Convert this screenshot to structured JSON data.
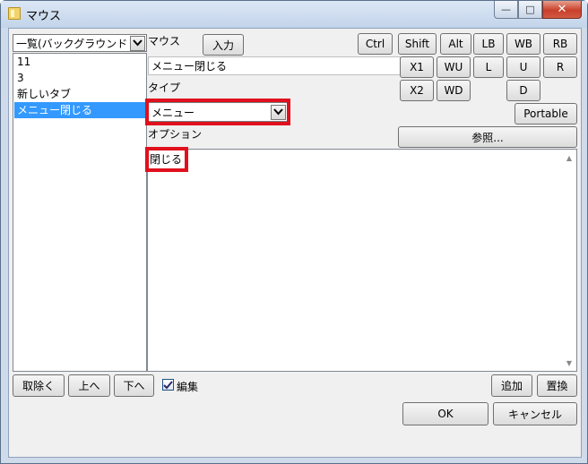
{
  "window": {
    "title": "マウス",
    "minimize": "—",
    "maximize": "□",
    "close": "✕"
  },
  "left": {
    "dropdown_value": "一覧(バックグラウンド",
    "items": [
      "11",
      "3",
      "新しいタブ",
      "メニュー閉じる"
    ],
    "selected_index": 3,
    "remove_button": "取除く",
    "up_button": "上へ",
    "down_button": "下へ"
  },
  "main": {
    "mouse_label": "マウス",
    "input_button": "入力",
    "mouse_value": "メニュー閉じる",
    "type_label": "タイプ",
    "type_value": "メニュー",
    "option_label": "オプション",
    "option_text": "閉じる",
    "edit_checkbox_label": "編集",
    "edit_checked": true,
    "add_button": "追加",
    "replace_button": "置換"
  },
  "keys": {
    "row1": [
      "Ctrl",
      "Shift",
      "Alt",
      "LB",
      "WB",
      "RB"
    ],
    "row2": [
      "X1",
      "WU",
      "L",
      "U",
      "R"
    ],
    "row3": [
      "X2",
      "WD",
      "D"
    ],
    "portable": "Portable",
    "browse": "参照..."
  },
  "footer": {
    "ok": "OK",
    "cancel": "キャンセル"
  }
}
